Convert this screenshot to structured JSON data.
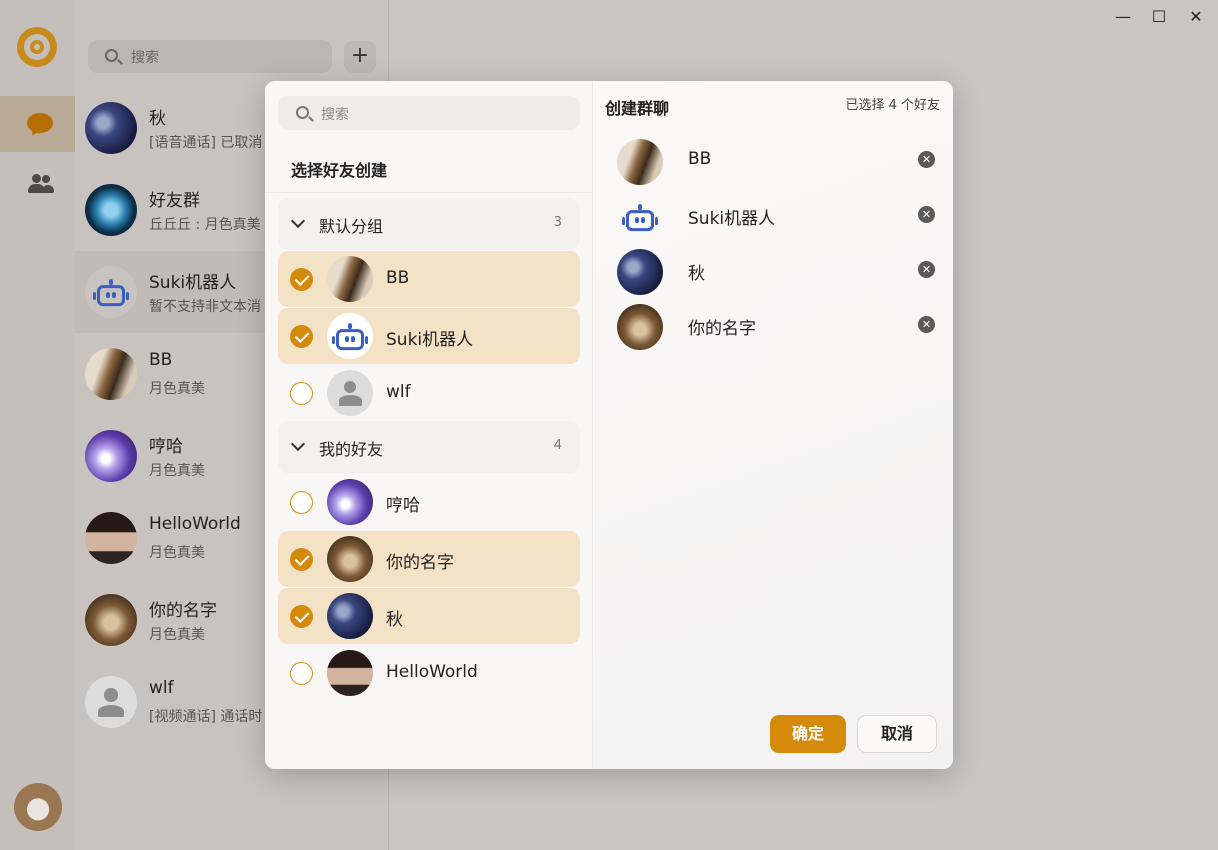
{
  "window_controls": {
    "minimize": "—",
    "maximize": "☐",
    "close": "✕"
  },
  "sidebar": {
    "search_placeholder": "搜索",
    "add_label": "+",
    "conversations": [
      {
        "name": "秋",
        "last_message": "[语音通话] 已取消",
        "avatar": "qiu"
      },
      {
        "name": "好友群",
        "last_message": "丘丘丘 : 月色真美",
        "avatar": "group"
      },
      {
        "name": "Suki机器人",
        "last_message": "暂不支持非文本消",
        "avatar": "robot"
      },
      {
        "name": "BB",
        "last_message": "月色真美",
        "avatar": "bb"
      },
      {
        "name": "哼哈",
        "last_message": "月色真美",
        "avatar": "henha"
      },
      {
        "name": "HelloWorld",
        "last_message": "月色真美",
        "avatar": "hello"
      },
      {
        "name": "你的名字",
        "last_message": "月色真美",
        "avatar": "name"
      },
      {
        "name": "wlf",
        "last_message": "[视频通话] 通话时",
        "avatar": "wlf"
      }
    ]
  },
  "modal": {
    "search_placeholder": "搜索",
    "subtitle": "选择好友创建",
    "groups": [
      {
        "name": "默认分组",
        "count": "3"
      },
      {
        "name": "我的好友",
        "count": "4"
      }
    ],
    "friends": [
      {
        "name": "BB",
        "selected": true
      },
      {
        "name": "Suki机器人",
        "selected": true
      },
      {
        "name": "wlf",
        "selected": false
      },
      {
        "name": "哼哈",
        "selected": false
      },
      {
        "name": "你的名字",
        "selected": true
      },
      {
        "name": "秋",
        "selected": true
      },
      {
        "name": "HelloWorld",
        "selected": false
      }
    ],
    "right_title": "创建群聊",
    "selected_count_text": "已选择 4 个好友",
    "selected": [
      {
        "name": "BB"
      },
      {
        "name": "Suki机器人"
      },
      {
        "name": "秋"
      },
      {
        "name": "你的名字"
      }
    ],
    "confirm_label": "确定",
    "cancel_label": "取消"
  },
  "colors": {
    "accent": "#d58a0b",
    "selected_row": "#f3e2c6",
    "robot_blue": "#3b5fc1"
  }
}
